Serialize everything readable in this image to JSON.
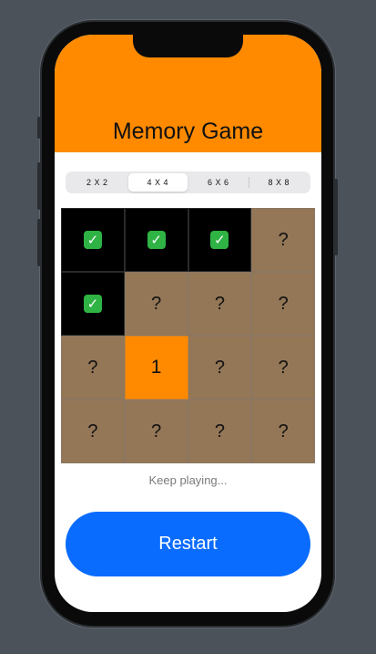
{
  "title": "Memory Game",
  "size_options": [
    "2 X 2",
    "4 X 4",
    "6 X 6",
    "8 X 8"
  ],
  "selected_size": "4 X 4",
  "board": {
    "rows": [
      [
        {
          "state": "matched",
          "label": "✓"
        },
        {
          "state": "matched",
          "label": "✓"
        },
        {
          "state": "matched",
          "label": "✓"
        },
        {
          "state": "hidden",
          "label": "?"
        }
      ],
      [
        {
          "state": "matched",
          "label": "✓"
        },
        {
          "state": "hidden",
          "label": "?"
        },
        {
          "state": "hidden",
          "label": "?"
        },
        {
          "state": "hidden",
          "label": "?"
        }
      ],
      [
        {
          "state": "hidden",
          "label": "?"
        },
        {
          "state": "revealed",
          "label": "1"
        },
        {
          "state": "hidden",
          "label": "?"
        },
        {
          "state": "hidden",
          "label": "?"
        }
      ],
      [
        {
          "state": "hidden",
          "label": "?"
        },
        {
          "state": "hidden",
          "label": "?"
        },
        {
          "state": "hidden",
          "label": "?"
        },
        {
          "state": "hidden",
          "label": "?"
        }
      ]
    ]
  },
  "status_text": "Keep playing...",
  "restart_label": "Restart",
  "colors": {
    "header": "#ff8a00",
    "hidden_card": "#947757",
    "matched_card": "#000000",
    "revealed_card": "#ff8a00",
    "restart_button": "#0a6cff"
  }
}
